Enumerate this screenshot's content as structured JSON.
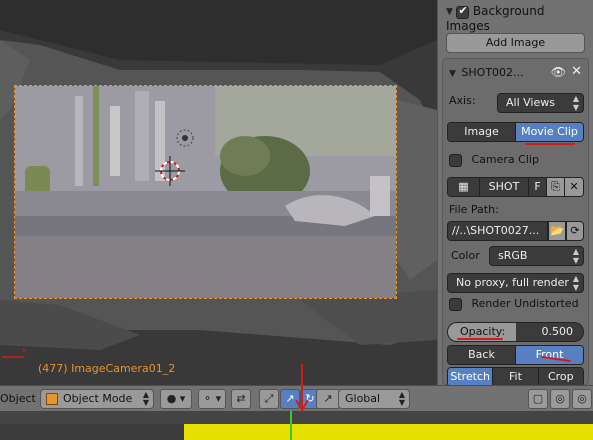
{
  "viewport": {
    "view_label": "(477) ImageCamera01_2"
  },
  "panel": {
    "bg_images": {
      "label": "Background Images",
      "enabled": true
    },
    "add_image_label": "Add Image",
    "item": {
      "name": "SHOT002...",
      "axis_label": "Axis:",
      "axis_value": "All Views",
      "source_tabs": [
        "Image",
        "Movie Clip"
      ],
      "source_selected": "Movie Clip",
      "camera_clip_label": "Camera Clip",
      "camera_clip_checked": false,
      "clip_name": "SHOT",
      "clip_f": "F",
      "file_path_label": "File Path:",
      "file_path_value": "//..\\SHOT0027...",
      "color_label": "Color",
      "color_value": "sRGB",
      "proxy_value": "No proxy, full render",
      "render_undistorted_label": "Render Undistorted",
      "render_undistorted_checked": false,
      "opacity_label": "Opacity:",
      "opacity_value": "0.500",
      "depth_tabs": [
        "Back",
        "Front"
      ],
      "depth_selected": "Front",
      "frame_tabs": [
        "Stretch",
        "Fit",
        "Crop"
      ],
      "frame_selected": "Stretch"
    }
  },
  "header": {
    "object_label": "Object",
    "mode_label": "Object Mode",
    "orientation_label": "Global"
  },
  "colors": {
    "accent_blue": "#5680c2",
    "camera_frame": "#e8932c",
    "annotation_red": "#d21c1c",
    "timeline_yellow": "#e6e000"
  }
}
